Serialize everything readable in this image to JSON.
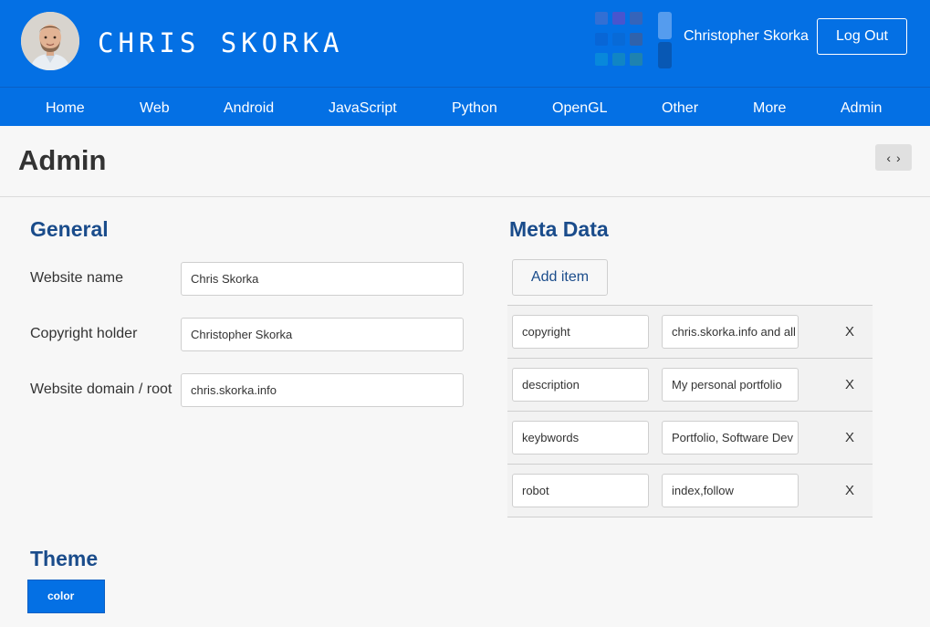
{
  "header": {
    "site_title": "CHRIS SKORKA",
    "user_name": "Christopher Skorka",
    "logout_label": "Log Out"
  },
  "nav": {
    "items": [
      {
        "label": "Home"
      },
      {
        "label": "Web"
      },
      {
        "label": "Android"
      },
      {
        "label": "JavaScript"
      },
      {
        "label": "Python"
      },
      {
        "label": "OpenGL"
      },
      {
        "label": "Other"
      },
      {
        "label": "More"
      },
      {
        "label": "Admin"
      }
    ]
  },
  "page": {
    "title": "Admin",
    "pager_prev": "‹",
    "pager_next": "›"
  },
  "general": {
    "title": "General",
    "fields": [
      {
        "label": "Website name",
        "value": "Chris Skorka"
      },
      {
        "label": "Copyright holder",
        "value": "Christopher Skorka"
      },
      {
        "label": "Website domain / root",
        "value": "chris.skorka.info"
      }
    ]
  },
  "meta": {
    "title": "Meta Data",
    "add_label": "Add item",
    "remove_label": "X",
    "rows": [
      {
        "key": "copyright",
        "value": "chris.skorka.info and all"
      },
      {
        "key": "description",
        "value": "My personal portfolio"
      },
      {
        "key": "keybwords",
        "value": "Portfolio, Software Dev"
      },
      {
        "key": "robot",
        "value": "index,follow"
      }
    ]
  },
  "theme": {
    "title": "Theme",
    "color_label": "color"
  },
  "colors": {
    "brand_blue": "#0470e4",
    "heading_blue": "#1a4c8b",
    "background": "#f7f7f7"
  },
  "icons": {
    "avatar": "profile-photo",
    "logo": "grid-squares-logo",
    "pager": "chevron-left-right-icon"
  }
}
